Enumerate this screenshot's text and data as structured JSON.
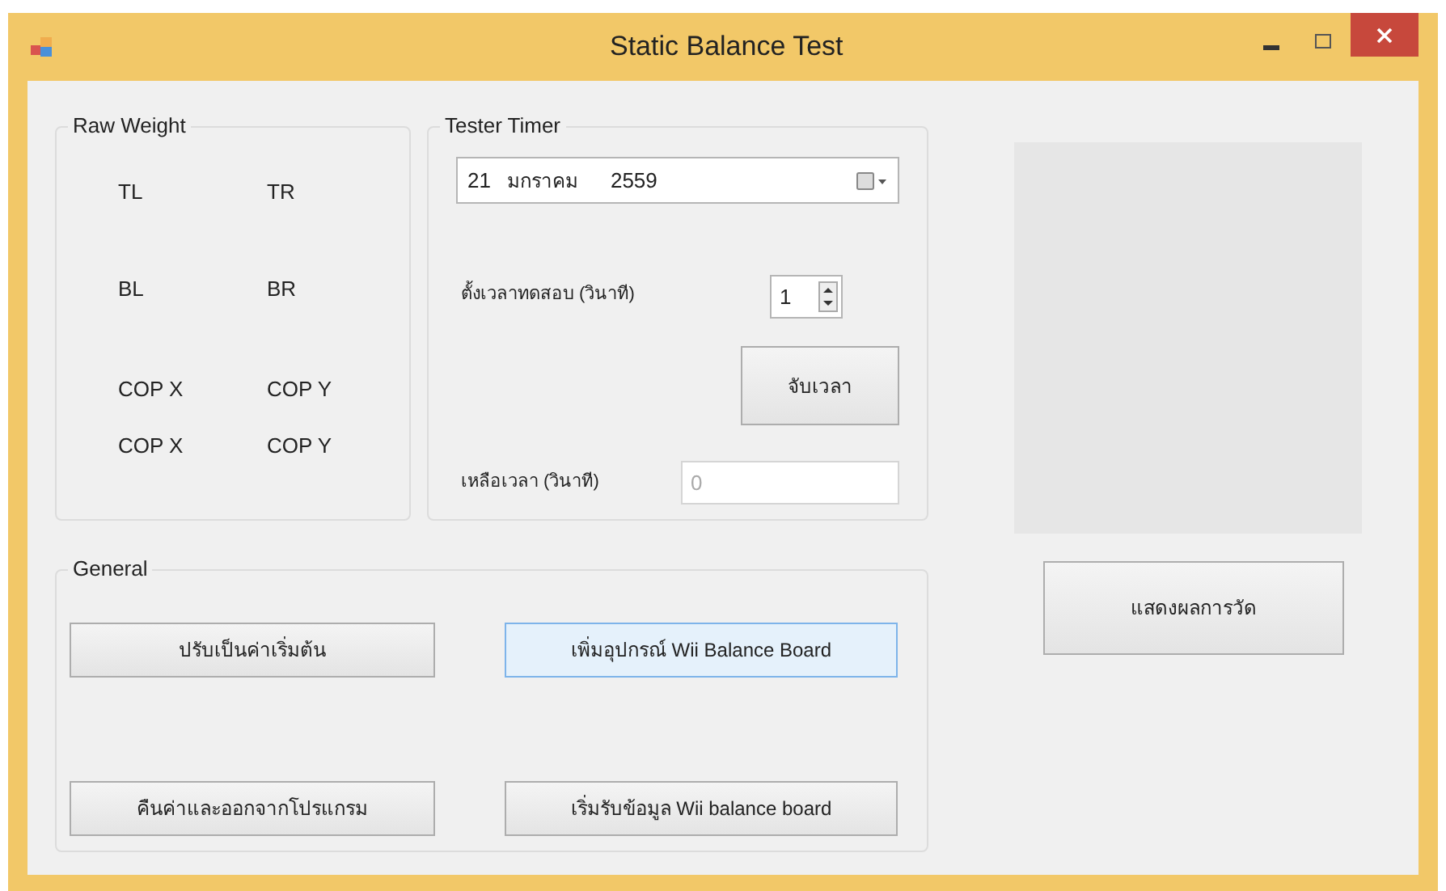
{
  "window": {
    "title": "Static Balance Test"
  },
  "raw_weight": {
    "title": "Raw Weight",
    "labels": [
      "TL",
      "TR",
      "BL",
      "BR",
      "COP X",
      "COP Y",
      "COP X",
      "COP Y"
    ]
  },
  "tester_timer": {
    "title": "Tester Timer",
    "date": {
      "day": "21",
      "month": "มกราคม",
      "year": "2559"
    },
    "test_time": {
      "label": "ตั้งเวลาทดสอบ (วินาที)",
      "value": "1"
    },
    "start_button": "จับเวลา",
    "remaining": {
      "label": "เหลือเวลา (วินาที)",
      "value": "0"
    }
  },
  "show_results_button": "แสดงผลการวัด",
  "general": {
    "title": "General",
    "buttons": [
      {
        "label": "ปรับเป็นค่าเริ่มต้น",
        "focused": false
      },
      {
        "label": "เพิ่มอุปกรณ์ Wii Balance Board",
        "focused": true
      },
      {
        "label": "คืนค่าและออกจากโปรแกรม",
        "focused": false
      },
      {
        "label": "เริ่มรับข้อมูล Wii balance board",
        "focused": false
      }
    ]
  }
}
